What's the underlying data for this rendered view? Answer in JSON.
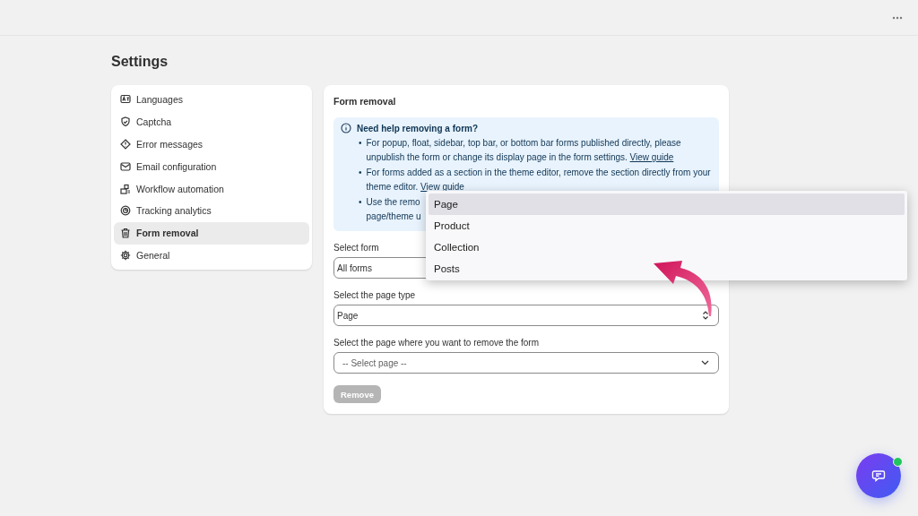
{
  "page": {
    "title": "Settings"
  },
  "sidebar": {
    "items": [
      {
        "label": "Languages",
        "selected": false
      },
      {
        "label": "Captcha",
        "selected": false
      },
      {
        "label": "Error messages",
        "selected": false
      },
      {
        "label": "Email configuration",
        "selected": false
      },
      {
        "label": "Workflow automation",
        "selected": false
      },
      {
        "label": "Tracking analytics",
        "selected": false
      },
      {
        "label": "Form removal",
        "selected": true
      },
      {
        "label": "General",
        "selected": false
      }
    ]
  },
  "panel": {
    "title": "Form removal",
    "notice": {
      "title": "Need help removing a form?",
      "bullets": [
        {
          "marker": "•",
          "lines": [
            "For popup, float, sidebar, top bar, or bottom bar forms published directly, please unpublish the form or change its display page in the form settings."
          ],
          "link": "View guide"
        },
        {
          "marker": "•",
          "lines": [
            "For forms added as a section in the theme editor, remove the section directly from your theme editor."
          ],
          "link": "View guide"
        },
        {
          "marker": "•",
          "lines": [
            "Use the remo",
            "page/theme u"
          ]
        }
      ]
    },
    "fields": [
      {
        "label": "Select form",
        "value": "All forms",
        "kind": "covered",
        "placeholder": false
      },
      {
        "label": "Select the page type",
        "value": "Page",
        "kind": "updown",
        "placeholder": false
      },
      {
        "label": "Select the page where you want to remove the form",
        "value": "-- Select page --",
        "kind": "select",
        "placeholder": true
      }
    ],
    "button": {
      "label": "Remove",
      "disabled": true
    }
  },
  "dropdown": {
    "options": [
      {
        "label": "Page",
        "selected": true
      },
      {
        "label": "Product",
        "selected": false
      },
      {
        "label": "Collection",
        "selected": false
      },
      {
        "label": "Posts",
        "selected": false
      }
    ]
  },
  "chat": {
    "online": true
  }
}
